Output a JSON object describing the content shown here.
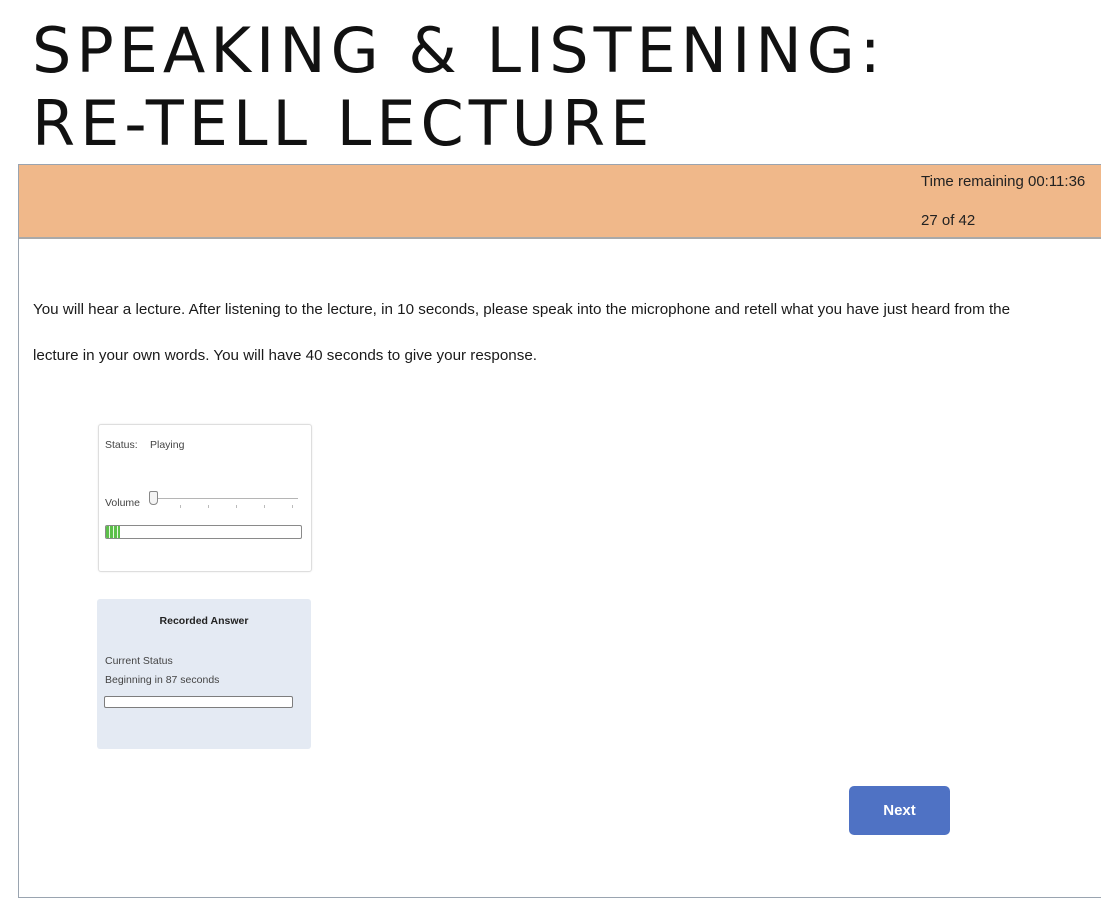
{
  "slide": {
    "title_line1": "SPEAKING & LISTENING:",
    "title_line2": "RE-TELL LECTURE"
  },
  "header": {
    "time_remaining": "Time remaining 00:11:36",
    "question_progress": "27 of 42",
    "background_color": "#f0b88a"
  },
  "instructions": {
    "text": "You will hear a lecture. After listening to the lecture, in 10 seconds, please speak into the microphone and retell what you have just heard from the lecture in your own words. You will have 40 seconds to give your response."
  },
  "audio_player": {
    "status_label": "Status:",
    "status_value": "Playing",
    "volume_label": "Volume",
    "volume_level": 0,
    "playback_progress": 0.07
  },
  "recorder": {
    "title": "Recorded Answer",
    "current_status_label": "Current Status",
    "current_status_value": "Beginning in 87 seconds",
    "recording_progress": 0
  },
  "navigation": {
    "next_label": "Next",
    "button_color": "#4f72c4"
  }
}
